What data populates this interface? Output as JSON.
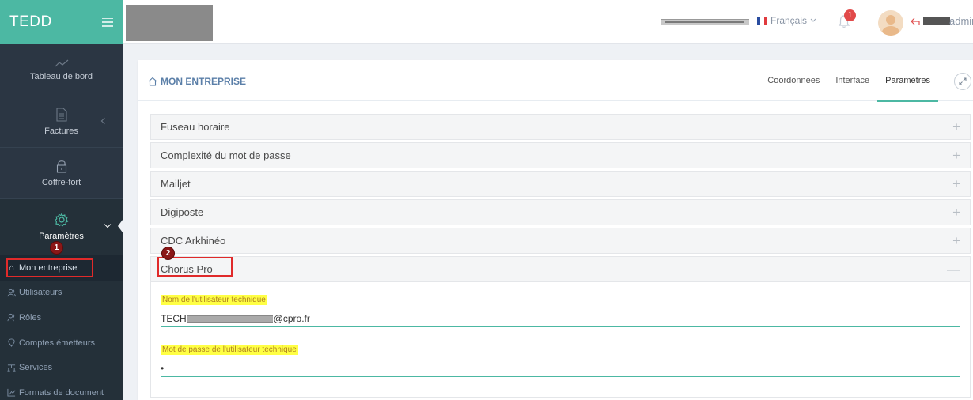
{
  "brand": {
    "name": "TEDD"
  },
  "header": {
    "language": "Français",
    "notification_count": "1",
    "username": "admir"
  },
  "sidebar": {
    "items": [
      {
        "label": "Tableau de bord"
      },
      {
        "label": "Factures"
      },
      {
        "label": "Coffre-fort"
      },
      {
        "label": "Paramètres"
      }
    ],
    "sub_items": [
      {
        "label": "Mon entreprise",
        "icon": "home-icon"
      },
      {
        "label": "Utilisateurs",
        "icon": "users-icon"
      },
      {
        "label": "Rôles",
        "icon": "roles-icon"
      },
      {
        "label": "Comptes émetteurs",
        "icon": "location-pin-icon"
      },
      {
        "label": "Services",
        "icon": "sitemap-icon"
      },
      {
        "label": "Formats de document",
        "icon": "chart-icon"
      }
    ]
  },
  "page": {
    "title": "MON ENTREPRISE",
    "tabs": [
      "Coordonnées",
      "Interface",
      "Paramètres"
    ],
    "active_tab": "Paramètres"
  },
  "panels": [
    {
      "title": "Fuseau horaire",
      "toggle": "+"
    },
    {
      "title": "Complexité du mot de passe",
      "toggle": "+"
    },
    {
      "title": "Mailjet",
      "toggle": "+"
    },
    {
      "title": "Digiposte",
      "toggle": "+"
    },
    {
      "title": "CDC Arkhinéo",
      "toggle": "+"
    },
    {
      "title": "Chorus Pro",
      "toggle": "—"
    }
  ],
  "chorus_pro": {
    "user_label": "Nom de l'utilisateur technique",
    "user_value_prefix": "TECH",
    "user_value_suffix": "@cpro.fr",
    "password_label": "Mot de passe de l'utilisateur technique",
    "password_value": "•"
  },
  "annotations": {
    "step1": "1",
    "step2": "2"
  },
  "colors": {
    "accent": "#4cb8a3",
    "sidebar": "#2b3643",
    "highlight": "#ffff44",
    "annotation_red": "#e02a2a"
  }
}
